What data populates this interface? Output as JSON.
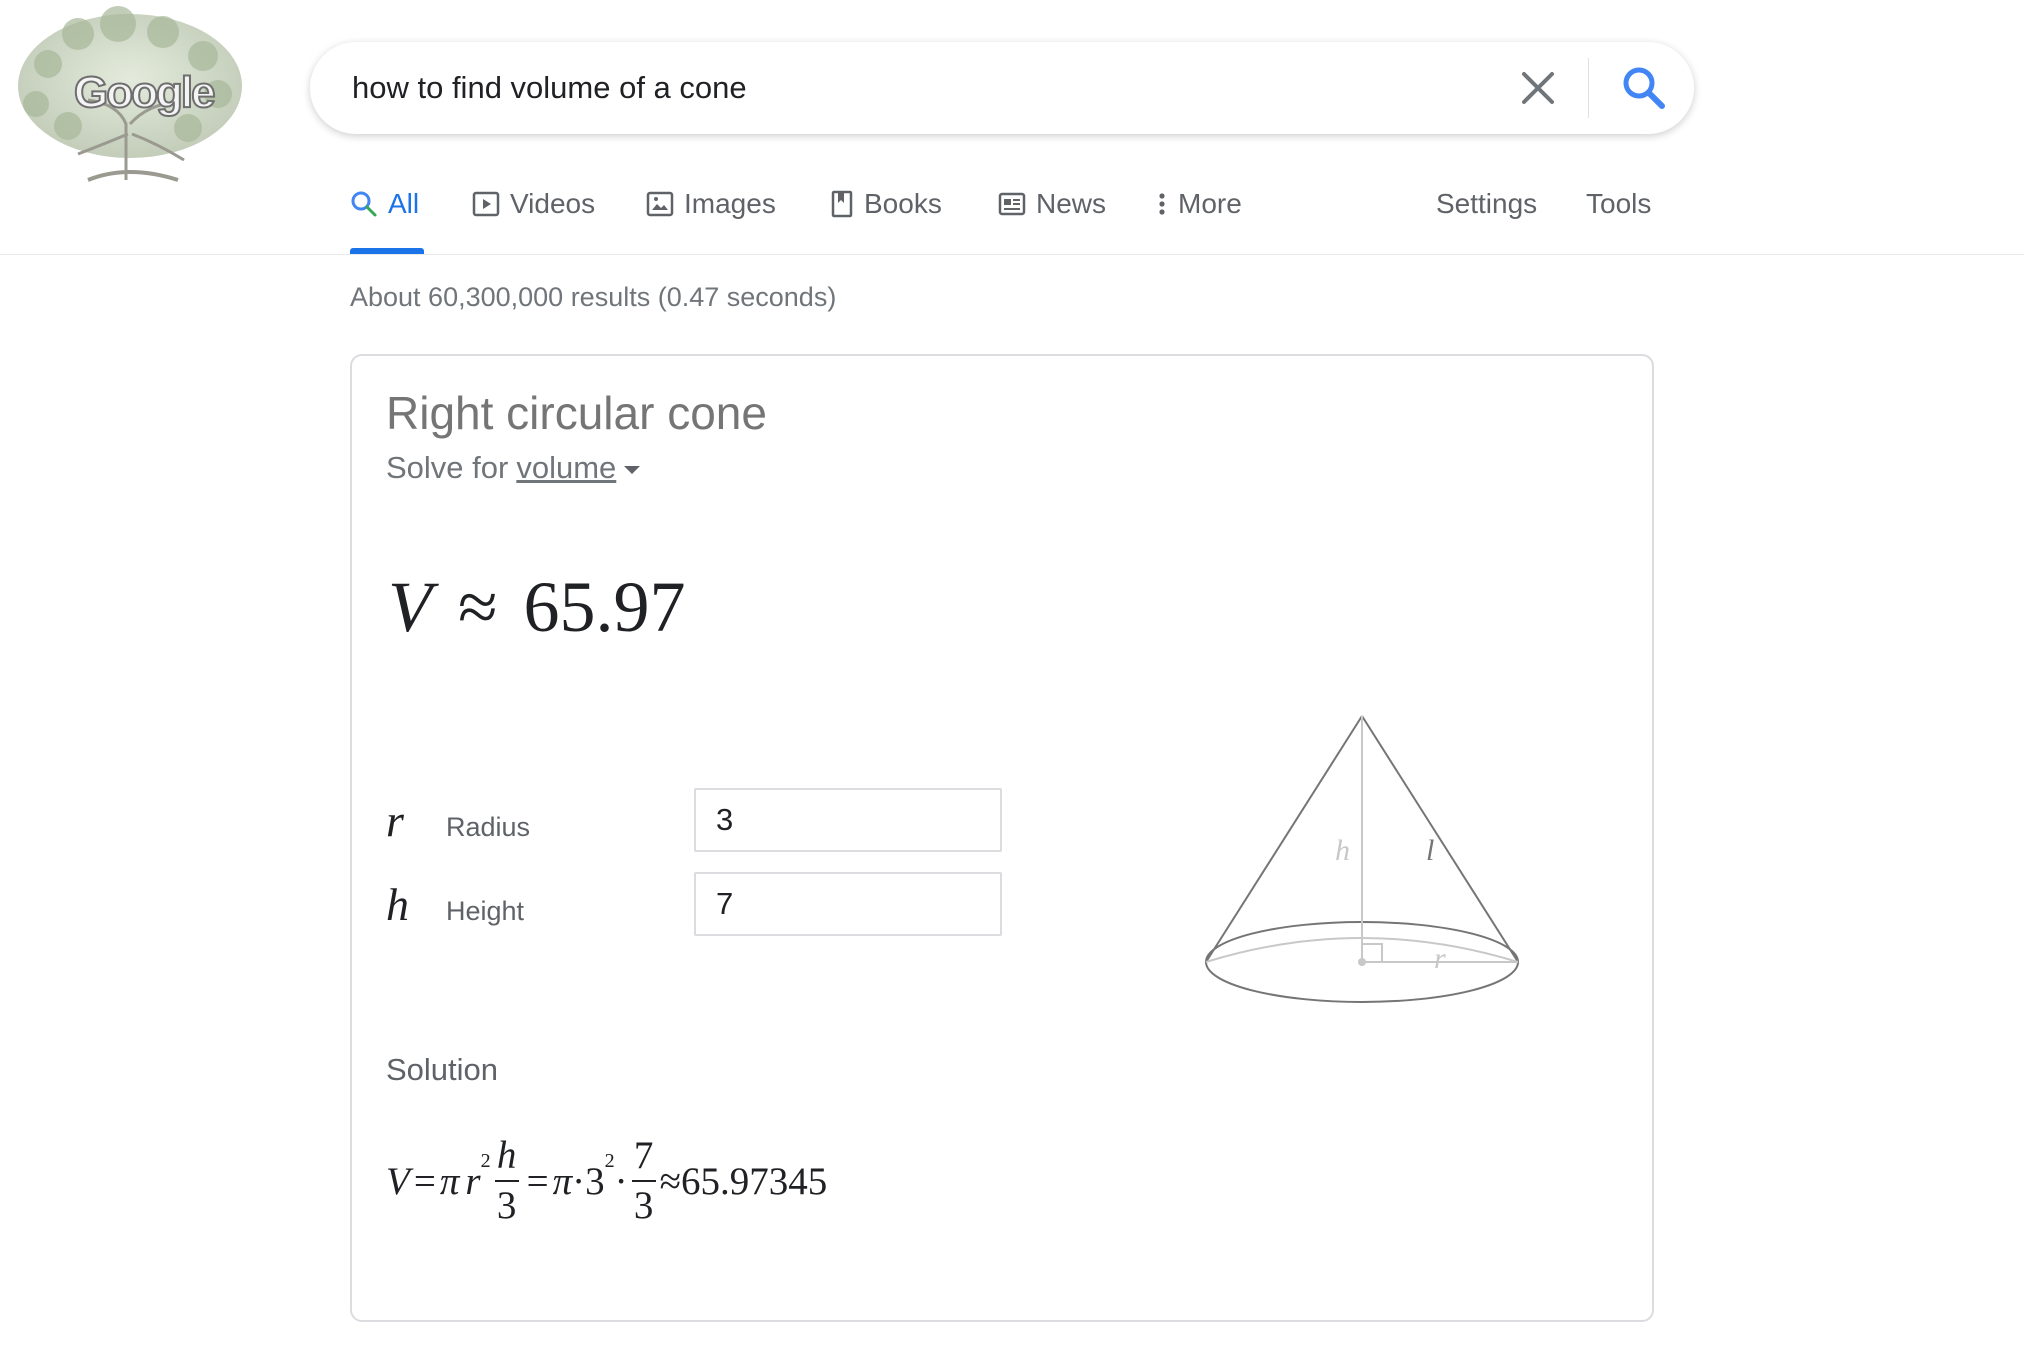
{
  "logo": {
    "text": "Google"
  },
  "search": {
    "query": "how to find volume of a cone"
  },
  "tabs": [
    {
      "label": "All",
      "icon": "search-icon",
      "active": true
    },
    {
      "label": "Videos",
      "icon": "video-icon"
    },
    {
      "label": "Images",
      "icon": "image-icon"
    },
    {
      "label": "Books",
      "icon": "book-icon"
    },
    {
      "label": "News",
      "icon": "news-icon"
    },
    {
      "label": "More",
      "icon": "more-vert-icon"
    }
  ],
  "settings_label": "Settings",
  "tools_label": "Tools",
  "result_stats": "About 60,300,000 results (0.47 seconds)",
  "calculator": {
    "title": "Right circular cone",
    "solve_prefix": "Solve for",
    "solve_for": "volume",
    "result": {
      "variable": "V",
      "approx": "≈",
      "value": "65.97"
    },
    "inputs": [
      {
        "symbol": "r",
        "label": "Radius",
        "value": "3"
      },
      {
        "symbol": "h",
        "label": "Height",
        "value": "7"
      }
    ],
    "diagram_labels": {
      "h": "h",
      "l": "l",
      "r": "r"
    },
    "solution_label": "Solution",
    "formula": {
      "v": "V",
      "eq": "=",
      "pi": "π",
      "r": "r",
      "r_exp": "2",
      "h": "h",
      "three": "3",
      "dot": "·",
      "base": "3",
      "base_exp": "2",
      "h_value": "7",
      "approx": "≈",
      "result": "65.97345"
    }
  },
  "colors": {
    "accent": "#1a73e8",
    "text_muted": "#70757a"
  }
}
